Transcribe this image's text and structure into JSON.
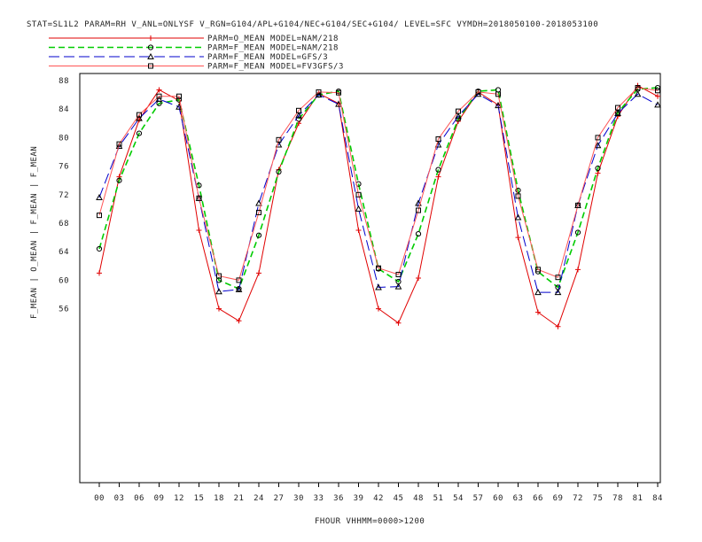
{
  "chart_data": {
    "type": "line",
    "title": "STAT=SL1L2 PARAM=RH V_ANL=ONLYSF V_RGN=G104/APL+G104/NEC+G104/SEC+G104/ LEVEL=SFC VYMDH=2018050100-2018053100",
    "xlabel": "FHOUR VHHMM=0000>1200",
    "ylabel": "F_MEAN | O_MEAN | F_MEAN | F_MEAN",
    "categories": [
      "00",
      "03",
      "06",
      "09",
      "12",
      "15",
      "18",
      "21",
      "24",
      "27",
      "30",
      "33",
      "36",
      "39",
      "42",
      "45",
      "48",
      "51",
      "54",
      "57",
      "60",
      "63",
      "66",
      "69",
      "72",
      "75",
      "78",
      "81",
      "84"
    ],
    "yticks": [
      56,
      60,
      64,
      68,
      72,
      76,
      80,
      84,
      88
    ],
    "ylim": [
      52.5,
      89
    ],
    "legend_position": "top-left",
    "grid": false,
    "series": [
      {
        "name": "PARM=O_MEAN MODEL=NAM/218",
        "color": "#e00000",
        "dash": "",
        "marker": "plus",
        "values": [
          61.0,
          74.5,
          82.5,
          86.7,
          85.2,
          67.0,
          56.0,
          54.3,
          61.0,
          75.5,
          82.0,
          86.2,
          84.8,
          67.0,
          56.0,
          54.0,
          60.3,
          74.5,
          82.3,
          86.4,
          84.6,
          66.0,
          55.5,
          53.5,
          61.5,
          75.0,
          83.0,
          87.3,
          85.8
        ]
      },
      {
        "name": "PARM=F_MEAN MODEL=NAM/218",
        "color": "#00cc00",
        "dash": "7,4",
        "marker": "diamond",
        "values": [
          64.4,
          74.0,
          80.6,
          84.8,
          85.3,
          73.3,
          60.0,
          58.8,
          66.3,
          75.2,
          82.6,
          86.0,
          86.5,
          73.5,
          61.6,
          59.8,
          66.5,
          75.5,
          82.6,
          86.5,
          86.7,
          72.6,
          61.2,
          59.0,
          66.7,
          75.7,
          83.5,
          86.8,
          87.0
        ]
      },
      {
        "name": "PARM=F_MEAN MODEL=GFS/3",
        "color": "#0000cc",
        "dash": "12,5",
        "marker": "triangle",
        "values": [
          71.6,
          78.8,
          82.7,
          85.4,
          84.3,
          71.5,
          58.4,
          58.7,
          70.8,
          79.0,
          83.1,
          86.0,
          84.7,
          70.0,
          59.0,
          59.1,
          70.8,
          79.0,
          83.0,
          86.1,
          84.5,
          68.8,
          58.3,
          58.3,
          70.5,
          78.9,
          83.4,
          86.1,
          84.6
        ]
      },
      {
        "name": "PARM=F_MEAN MODEL=FV3GFS/3",
        "color": "#ff5555",
        "dash": "",
        "marker": "square",
        "values": [
          69.1,
          79.1,
          83.2,
          85.8,
          85.8,
          71.5,
          60.6,
          60.0,
          69.5,
          79.7,
          83.8,
          86.4,
          86.3,
          72.0,
          61.7,
          60.8,
          69.8,
          79.8,
          83.7,
          86.4,
          86.1,
          71.8,
          61.5,
          60.4,
          70.5,
          80.0,
          84.2,
          87.0,
          86.6
        ]
      }
    ]
  }
}
